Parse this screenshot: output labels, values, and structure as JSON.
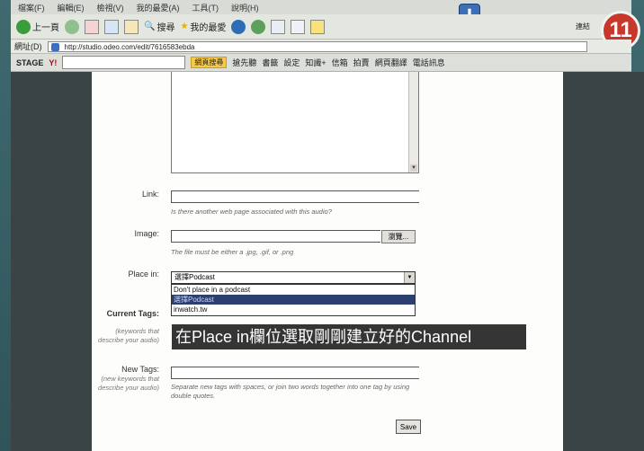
{
  "browser": {
    "menu": [
      "檔案(F)",
      "編輯(E)",
      "檢視(V)",
      "我的最愛(A)",
      "工具(T)",
      "說明(H)"
    ],
    "toolbar": {
      "back_label": "上一頁",
      "search_label": "搜尋",
      "favorites_label": "我的最愛",
      "right_label": "連結"
    },
    "address_label": "網址(D)",
    "address_value": "http://studio.odeo.com/edit/7616583ebda",
    "yahoo": {
      "brand": "STAGE",
      "logo": "Y!",
      "search_button": "網頁搜尋",
      "items": [
        "搶先聽",
        "書籤",
        "設定",
        "知識+",
        "信箱",
        "拍賣",
        "網頁翻譯",
        "電話訊息"
      ]
    }
  },
  "form": {
    "link_label": "Link:",
    "link_hint": "Is there another web page associated with this audio?",
    "image_label": "Image:",
    "image_hint": "The file must be either a .jpg, .gif, or .png",
    "browse_label": "瀏覽...",
    "place_label": "Place in:",
    "place_selected": "選擇Podcast",
    "place_options": [
      "Don't place in a podcast",
      "選擇Podcast",
      "inwatch.tw"
    ],
    "current_tags_label": "Current Tags:",
    "current_tags_hint": "(keywords that describe your audio)",
    "new_tags_label": "New Tags:",
    "new_tags_hint": "(new keywords that describe your audio)",
    "tags_help": "Separate new tags with spaces, or join two words together into one tag by using double quotes.",
    "save_label": "Save"
  },
  "overlay": {
    "caption": "在Place in欄位選取剛剛建立好的Channel",
    "step": "11"
  },
  "colors": {
    "caption_bg": "#191919",
    "badge": "#c8372c",
    "selected_option": "#2d3f6e"
  }
}
